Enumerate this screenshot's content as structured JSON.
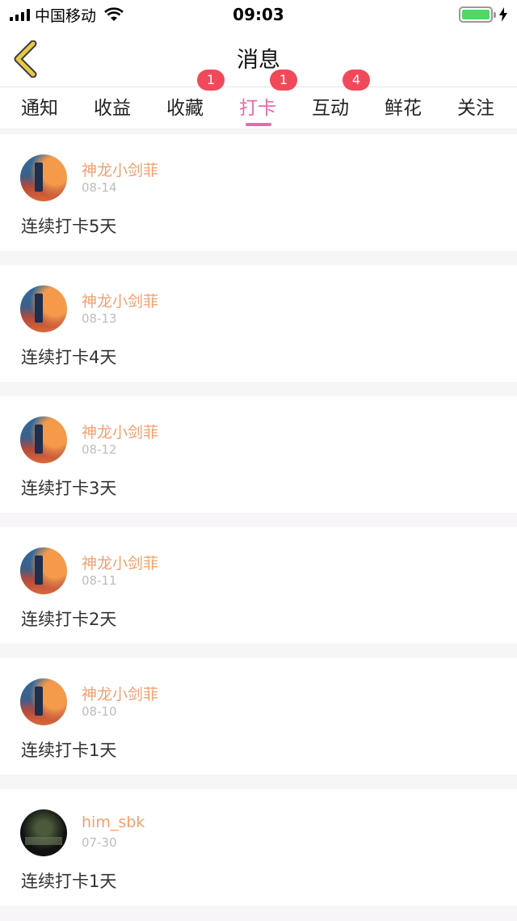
{
  "status_bar": {
    "carrier": "中国移动",
    "time": "09:03",
    "battery_level": 1.0,
    "signal_icon": "signal-bars-icon",
    "wifi_icon": "wifi-icon",
    "battery_icon": "battery-icon",
    "charging_icon": "charging-bolt-icon"
  },
  "nav": {
    "title": "消息",
    "back_icon": "chevron-left-icon",
    "back_color": "#e8c84a"
  },
  "tabs": [
    {
      "label": "通知",
      "badge": ""
    },
    {
      "label": "收益",
      "badge": ""
    },
    {
      "label": "收藏",
      "badge": "1"
    },
    {
      "label": "打卡",
      "badge": "1",
      "active": true
    },
    {
      "label": "互动",
      "badge": "4"
    },
    {
      "label": "鲜花",
      "badge": ""
    },
    {
      "label": "关注",
      "badge": ""
    }
  ],
  "colors": {
    "accent": "#e96aa8",
    "username": "#f0a070",
    "badge": "#f04a5a"
  },
  "messages": [
    {
      "username": "神龙小剑菲",
      "date": "08-14",
      "content": "连续打卡5天"
    },
    {
      "username": "神龙小剑菲",
      "date": "08-13",
      "content": "连续打卡4天"
    },
    {
      "username": "神龙小剑菲",
      "date": "08-12",
      "content": "连续打卡3天"
    },
    {
      "username": "神龙小剑菲",
      "date": "08-11",
      "content": "连续打卡2天"
    },
    {
      "username": "神龙小剑菲",
      "date": "08-10",
      "content": "连续打卡1天"
    },
    {
      "username": "him_sbk",
      "date": "07-30",
      "content": "连续打卡1天"
    }
  ]
}
